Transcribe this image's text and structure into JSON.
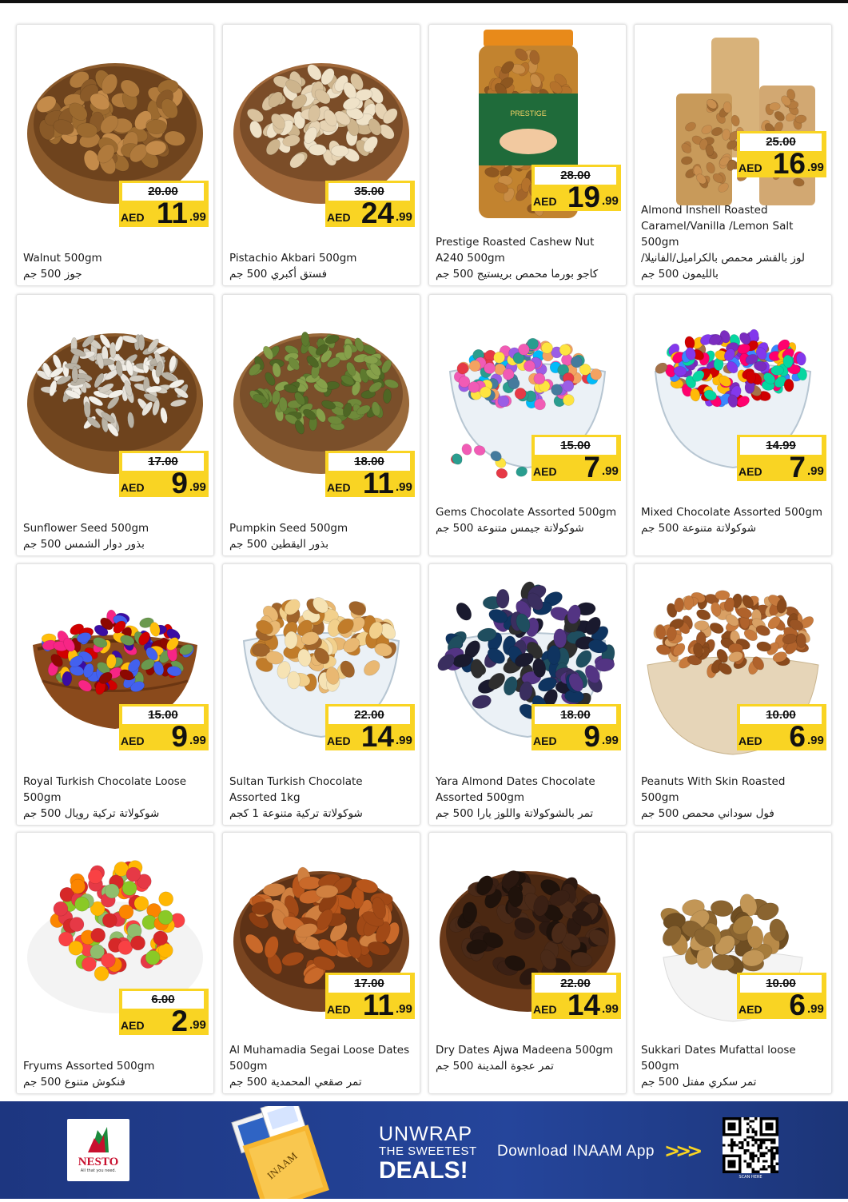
{
  "currency": "AED",
  "products": [
    {
      "name": "Walnut 500gm",
      "arabic": "جوز 500 جم",
      "old_price": "20.00",
      "price_main": "11",
      "price_dec": ".99",
      "img": "walnut"
    },
    {
      "name": "Pistachio Akbari 500gm",
      "arabic": "فستق أكبري 500 جم",
      "old_price": "35.00",
      "price_main": "24",
      "price_dec": ".99",
      "img": "pistachio"
    },
    {
      "name": "Prestige Roasted Cashew Nut A240 500gm",
      "arabic": "كاجو بورما محمص بريستيج 500 جم",
      "old_price": "28.00",
      "price_main": "19",
      "price_dec": ".99",
      "img": "cashew-jar"
    },
    {
      "name": "Almond Inshell Roasted Caramel/Vanilla /Lemon Salt 500gm",
      "arabic": "لوز بالقشر محمص بالكراميل/الفانيلا/بالليمون 500 جم",
      "old_price": "25.00",
      "price_main": "16",
      "price_dec": ".99",
      "img": "almond-bags"
    },
    {
      "name": "Sunflower Seed 500gm",
      "arabic": "بذور دوار الشمس 500 جم",
      "old_price": "17.00",
      "price_main": "9",
      "price_dec": ".99",
      "img": "sunflower"
    },
    {
      "name": "Pumpkin Seed 500gm",
      "arabic": "بذور اليقطين 500 جم",
      "old_price": "18.00",
      "price_main": "11",
      "price_dec": ".99",
      "img": "pumpkin"
    },
    {
      "name": "Gems Chocolate Assorted 500gm",
      "arabic": "شوكولاتة جيمس متنوعة 500 جم",
      "old_price": "15.00",
      "price_main": "7",
      "price_dec": ".99",
      "img": "gems"
    },
    {
      "name": "Mixed Chocolate Assorted 500gm",
      "arabic": "شوكولاتة متنوعة 500 جم",
      "old_price": "14.99",
      "price_main": "7",
      "price_dec": ".99",
      "img": "mixed-choc"
    },
    {
      "name": "Royal Turkish Chocolate Loose 500gm",
      "arabic": "شوكولاتة تركية رويال 500 جم",
      "old_price": "15.00",
      "price_main": "9",
      "price_dec": ".99",
      "img": "royal-choc"
    },
    {
      "name": "Sultan Turkish Chocolate Assorted 1kg",
      "arabic": "شوكولاتة تركية متنوعة 1 كجم",
      "old_price": "22.00",
      "price_main": "14",
      "price_dec": ".99",
      "img": "sultan-choc"
    },
    {
      "name": "Yara Almond Dates Chocolate Assorted 500gm",
      "arabic": "تمر بالشوكولاتة واللوز يارا 500 جم",
      "old_price": "18.00",
      "price_main": "9",
      "price_dec": ".99",
      "img": "yara-choc"
    },
    {
      "name": "Peanuts With Skin Roasted 500gm",
      "arabic": "فول سوداني محمص 500 جم",
      "old_price": "10.00",
      "price_main": "6",
      "price_dec": ".99",
      "img": "peanuts"
    },
    {
      "name": "Fryums Assorted 500gm",
      "arabic": "فنكوش متنوع 500 جم",
      "old_price": "6.00",
      "price_main": "2",
      "price_dec": ".99",
      "img": "fryums"
    },
    {
      "name": "Al Muhamadia Segai Loose Dates 500gm",
      "arabic": "تمر صقعي المحمدية 500 جم",
      "old_price": "17.00",
      "price_main": "11",
      "price_dec": ".99",
      "img": "segai-dates"
    },
    {
      "name": "Dry Dates Ajwa Madeena 500gm",
      "arabic": "تمر عجوة المدينة 500 جم",
      "old_price": "22.00",
      "price_main": "14",
      "price_dec": ".99",
      "img": "ajwa-dates"
    },
    {
      "name": "Sukkari Dates Mufattal loose 500gm",
      "arabic": "تمر سكري مفتل 500 جم",
      "old_price": "10.00",
      "price_main": "6",
      "price_dec": ".99",
      "img": "sukkari-dates"
    }
  ],
  "footer": {
    "logo_text": "NESTO",
    "logo_tagline": "All that you need.",
    "promo_line1": "UNWRAP",
    "promo_line2": "THE SWEETEST",
    "promo_line3": "DEALS!",
    "download_text": "Download INAAM App",
    "chevrons": ">>>",
    "scan_text": "SCAN HERE",
    "card_brand": "INAAM"
  },
  "colors": {
    "price_yellow": "#f9d423",
    "footer_blue": "#1e3a8a",
    "logo_red": "#c8102e"
  }
}
